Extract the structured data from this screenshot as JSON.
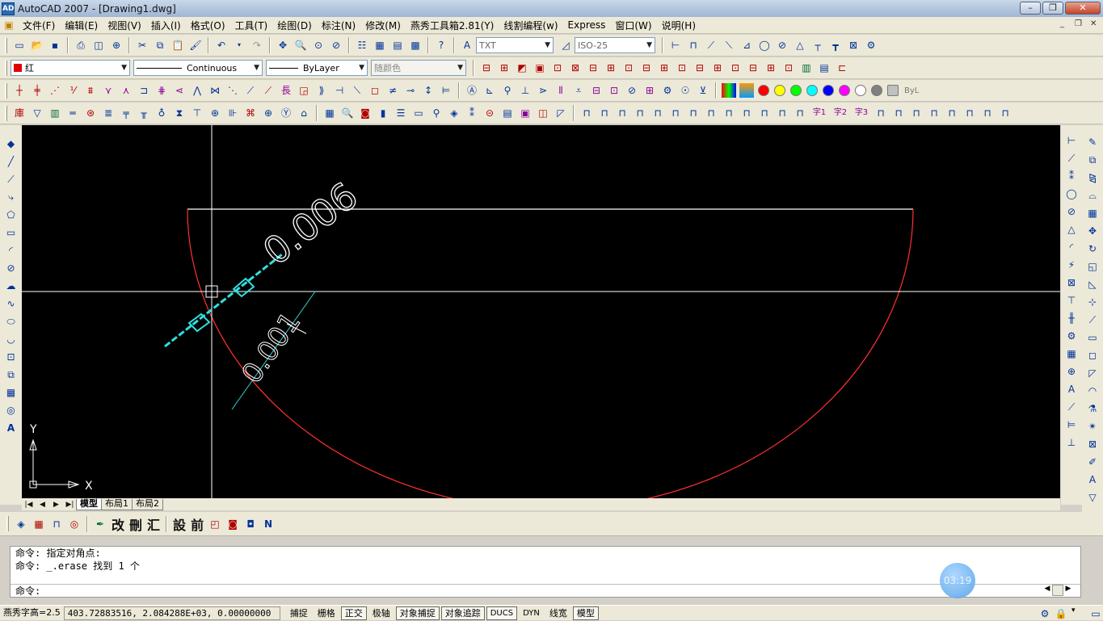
{
  "window": {
    "title": "AutoCAD 2007 - [Drawing1.dwg]",
    "app_icon_label": "AD"
  },
  "menu": [
    "文件(F)",
    "编辑(E)",
    "视图(V)",
    "插入(I)",
    "格式(O)",
    "工具(T)",
    "绘图(D)",
    "标注(N)",
    "修改(M)",
    "燕秀工具箱2.81(Y)",
    "线割编程(w)",
    "Express",
    "窗口(W)",
    "说明(H)"
  ],
  "toolbar1": {
    "text_style": "TXT",
    "dim_style": "ISO-25"
  },
  "properties": {
    "color": "红",
    "color_hex": "#e00000",
    "linetype": "Continuous",
    "lineweight": "ByLayer",
    "plotstyle": "随颜色"
  },
  "color_swatches": [
    "#ff0000",
    "#ffff00",
    "#00ff00",
    "#00ffff",
    "#0000ff",
    "#ff00ff",
    "#ffffff",
    "#808080",
    "#c0c0c0"
  ],
  "swatch_label": "ByL",
  "toolbar4_text": [
    "字1",
    "字2",
    "字3"
  ],
  "drawing": {
    "dim_upper": "0.006",
    "dim_lower": "0.001",
    "ucs_x": "X",
    "ucs_y": "Y"
  },
  "layout_tabs": {
    "model": "模型",
    "layout1": "布局1",
    "layout2": "布局2"
  },
  "bottom_toolbar_chars": [
    "改",
    "刪",
    "汇",
    "設",
    "前"
  ],
  "command": {
    "history": [
      "命令: 指定对角点:",
      "命令: _.erase 找到 1 个"
    ],
    "prompt": "命令:"
  },
  "timer": "03:19",
  "status": {
    "text_height": "燕秀字高=2.5",
    "coords": "403.72883516, 2.084288E+03, 0.00000000",
    "snap": "捕捉",
    "grid": "栅格",
    "ortho": "正交",
    "polar": "极轴",
    "osnap": "对象捕捉",
    "otrack": "对象追踪",
    "ducs": "DUCS",
    "dyn": "DYN",
    "lwt": "线宽",
    "model": "模型"
  }
}
